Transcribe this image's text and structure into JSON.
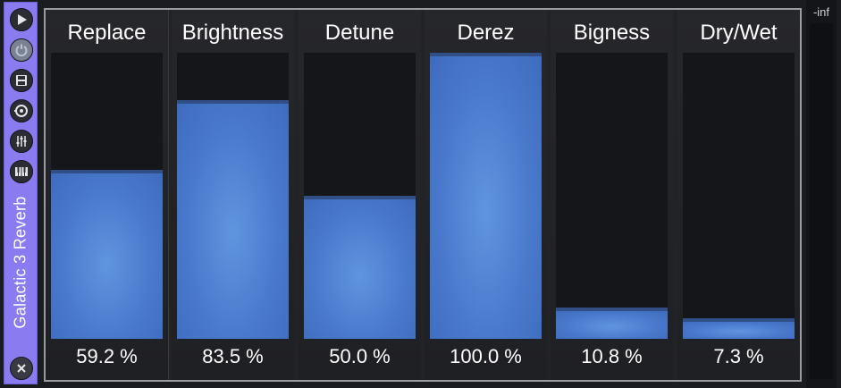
{
  "plugin": {
    "name": "Galactic 3 Reverb",
    "accent_color": "#8a7bf0",
    "strip_icons": [
      "play-icon",
      "power-icon",
      "save-icon",
      "sync-icon",
      "mixer-icon",
      "keyboard-icon",
      "close-icon"
    ]
  },
  "sliders": [
    {
      "label": "Replace",
      "value_text": "59.2 %",
      "fraction": 0.592
    },
    {
      "label": "Brightness",
      "value_text": "83.5 %",
      "fraction": 0.835
    },
    {
      "label": "Detune",
      "value_text": "50.0 %",
      "fraction": 0.5
    },
    {
      "label": "Derez",
      "value_text": "100.0 %",
      "fraction": 1.0
    },
    {
      "label": "Bigness",
      "value_text": "10.8 %",
      "fraction": 0.108
    },
    {
      "label": "Dry/Wet",
      "value_text": "7.3 %",
      "fraction": 0.073
    }
  ],
  "meter": {
    "label": "-inf"
  },
  "colors": {
    "fill": "#4a7acd",
    "track": "#15161a",
    "panel_border": "#9a9ca2"
  }
}
